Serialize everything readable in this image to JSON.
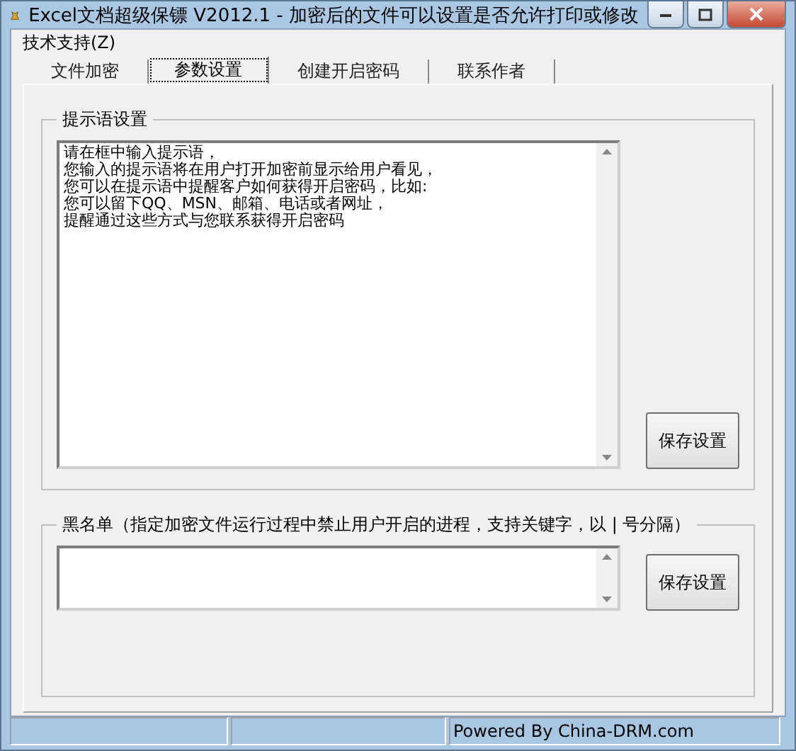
{
  "window": {
    "title": "Excel文档超级保镖 V2012.1 - 加密后的文件可以设置是否允许打印或修改"
  },
  "menu": [
    "技术支持(Z)"
  ],
  "tabs": [
    {
      "label": "文件加密",
      "selected": false
    },
    {
      "label": "参数设置",
      "selected": true
    },
    {
      "label": "创建开启密码",
      "selected": false
    },
    {
      "label": "联系作者",
      "selected": false
    }
  ],
  "prompt_group": {
    "title": "提示语设置",
    "lines": [
      "请在框中输入提示语，",
      "您输入的提示语将在用户打开加密前显示给用户看见，",
      "您可以在提示语中提醒客户如何获得开启密码，比如:",
      "您可以留下QQ、MSN、邮箱、电话或者网址，",
      "提醒通过这些方式与您联系获得开启密码"
    ],
    "button": "保存设置"
  },
  "blacklist_group": {
    "title": "黑名单（指定加密文件运行过程中禁止用户开启的进程，支持关键字，以 | 号分隔）",
    "button": "保存设置"
  },
  "status_bar": {
    "credit": "Powered By China-DRM.com"
  }
}
